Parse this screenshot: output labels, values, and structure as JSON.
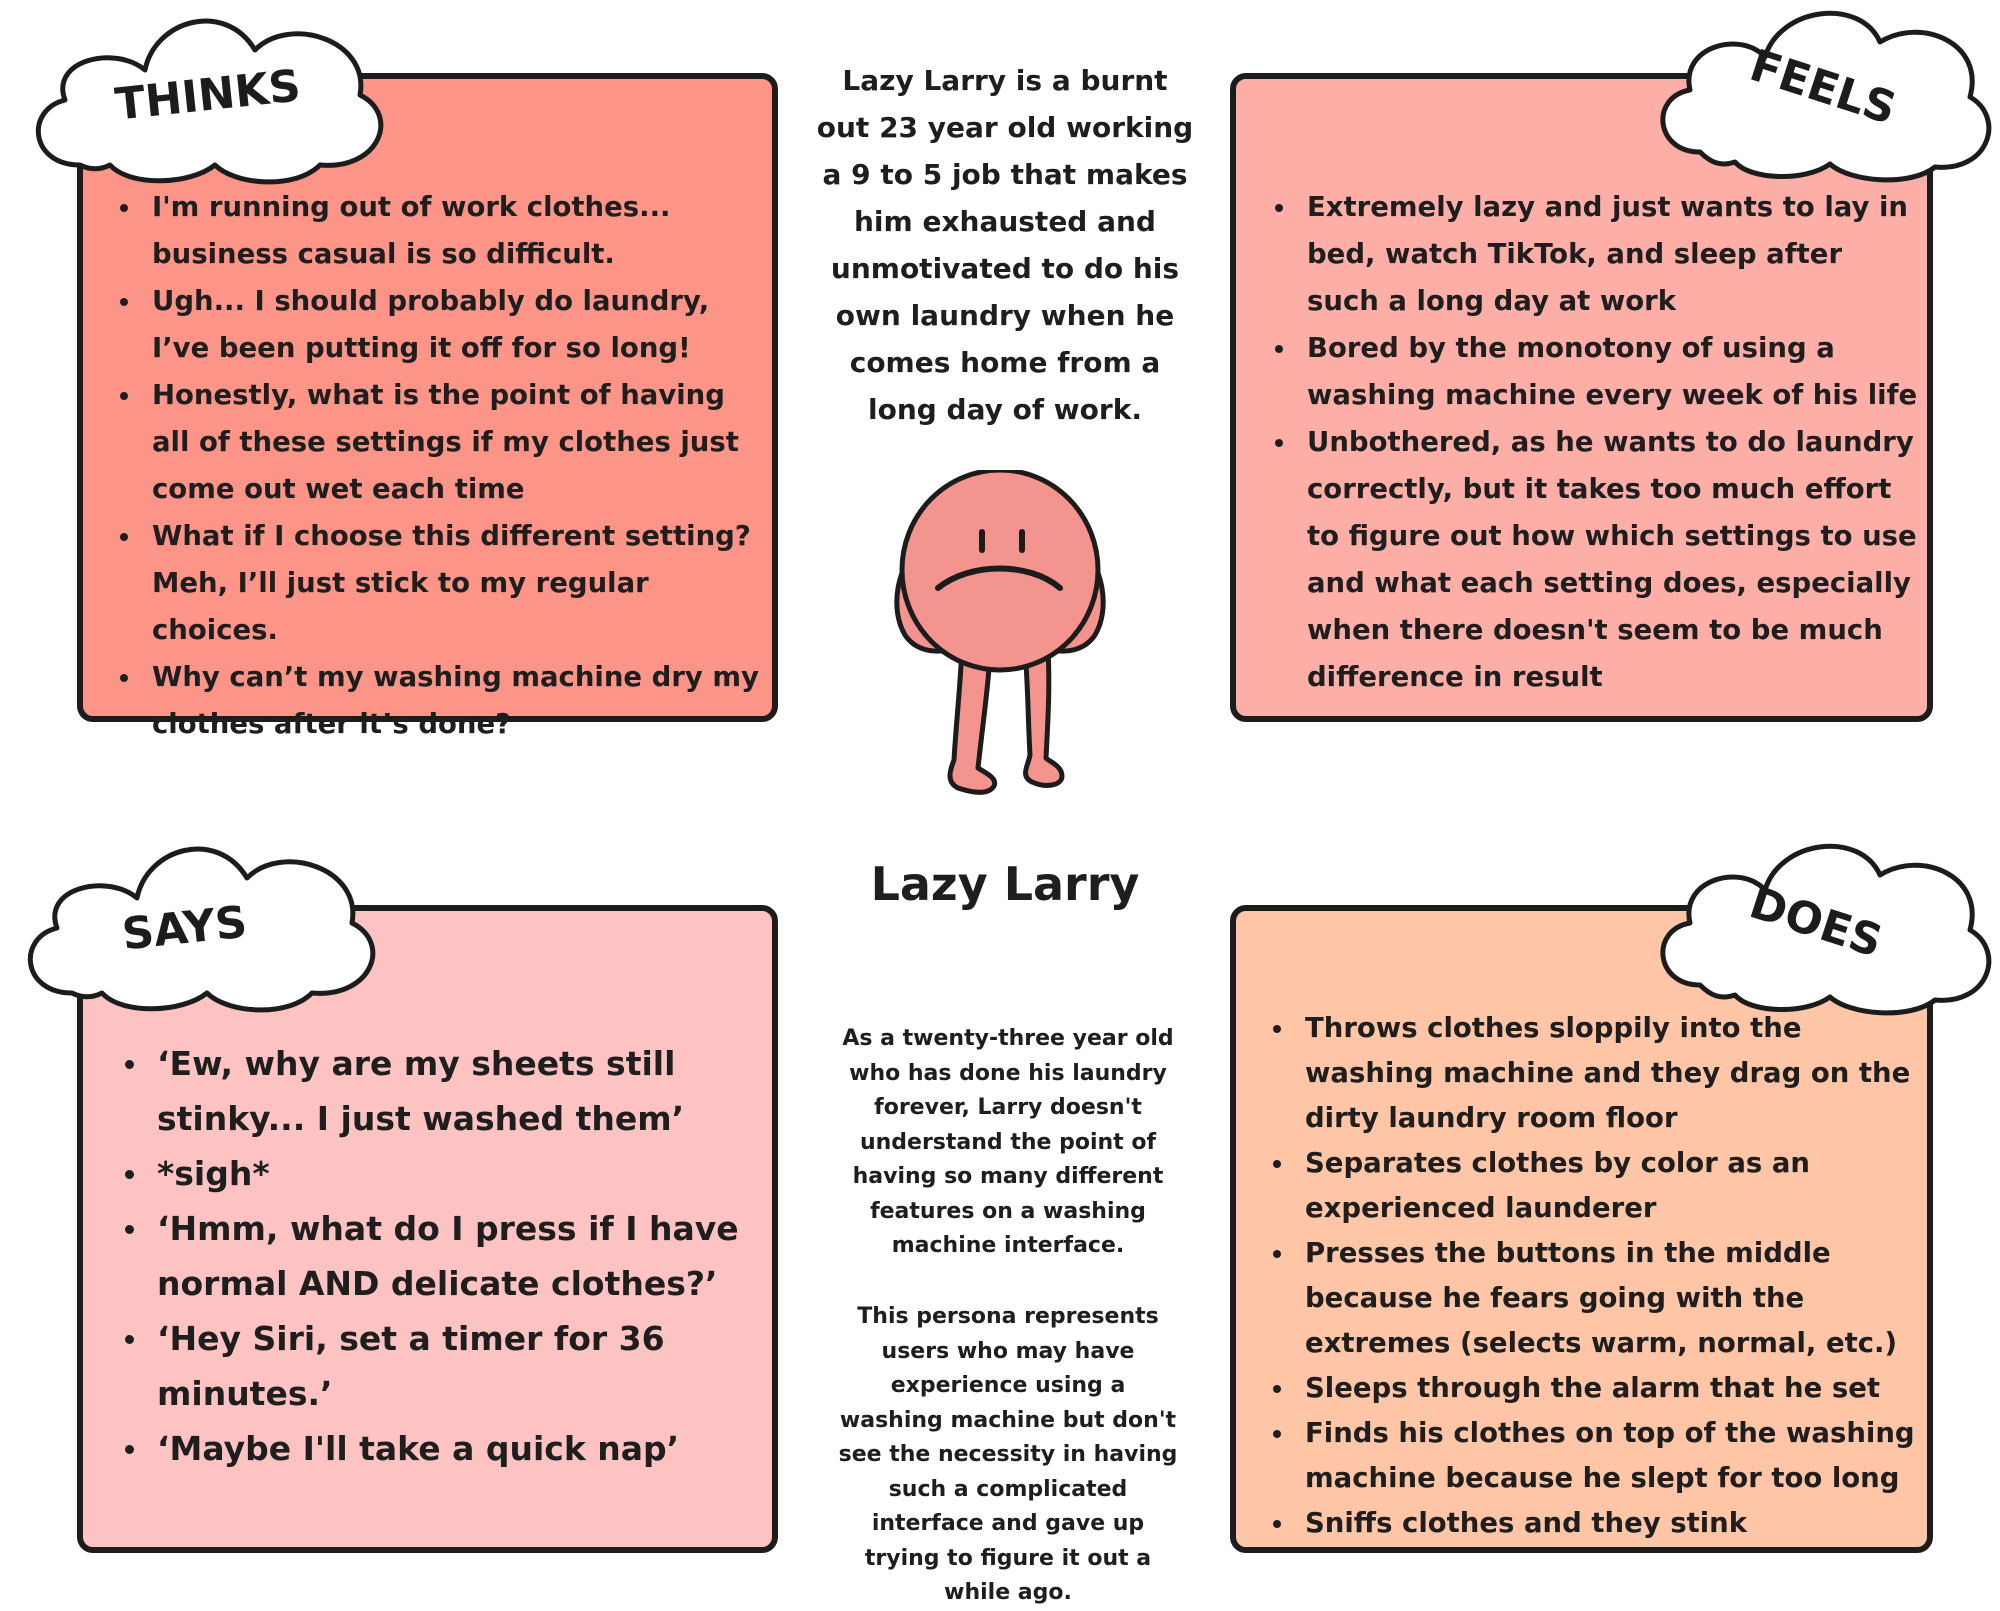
{
  "colors": {
    "thinks_bg": "#fd9488",
    "feels_bg": "#fdaea7",
    "says_bg": "#fdc3c2",
    "does_bg": "#fec5a6",
    "character_fill": "#f4948e",
    "outline": "#1c1c1c"
  },
  "intro": "Lazy Larry is a burnt out 23 year old working a 9 to 5 job that makes him exhausted and unmotivated to do his own laundry when he comes home from a long day of work.",
  "persona_name": "Lazy Larry",
  "description": [
    "As a twenty-three year old who has done his laundry forever, Larry doesn't understand the point of having so many different features on a washing machine interface.",
    "This persona represents users who may have experience using a washing machine but don't see the necessity in having such a complicated interface and gave up trying to figure it out a while ago."
  ],
  "quadrants": {
    "thinks": {
      "label": "THINKS",
      "items": [
        "I'm running out of work clothes... business casual is so difficult.",
        "Ugh... I should probably do laundry, I’ve been putting it off for so long!",
        "Honestly, what is the point of having all of these settings if my clothes just come out wet each time",
        "What if I choose this different setting? Meh, I’ll just stick to my regular choices.",
        "Why can’t my washing machine dry my clothes after it’s done?"
      ]
    },
    "feels": {
      "label": "FEELS",
      "items": [
        "Extremely lazy and just wants to lay in bed, watch TikTok, and sleep after such a long day at work",
        "Bored by the monotony of using a washing machine every week of his life",
        "Unbothered, as he wants to do laundry correctly, but it takes too much effort to figure out how which settings to use and what each setting does, especially when there doesn't seem to be much difference in result"
      ]
    },
    "says": {
      "label": "SAYS",
      "items": [
        "‘Ew, why are my sheets still stinky... I just washed them’",
        "*sigh*",
        "‘Hmm, what do I press if I have normal AND delicate clothes?’",
        "‘Hey Siri, set a timer for 36 minutes.’",
        "‘Maybe I'll take a quick nap’"
      ]
    },
    "does": {
      "label": "DOES",
      "items": [
        "Throws clothes sloppily into the washing machine and they drag on the dirty laundry room floor",
        "Separates clothes by color as an experienced launderer",
        "Presses the buttons in the middle because he fears going with the extremes (selects warm, normal, etc.)",
        "Sleeps through the alarm that he set",
        "Finds his clothes on top of the washing machine because he slept for too long",
        "Sniffs clothes and they stink"
      ]
    }
  }
}
